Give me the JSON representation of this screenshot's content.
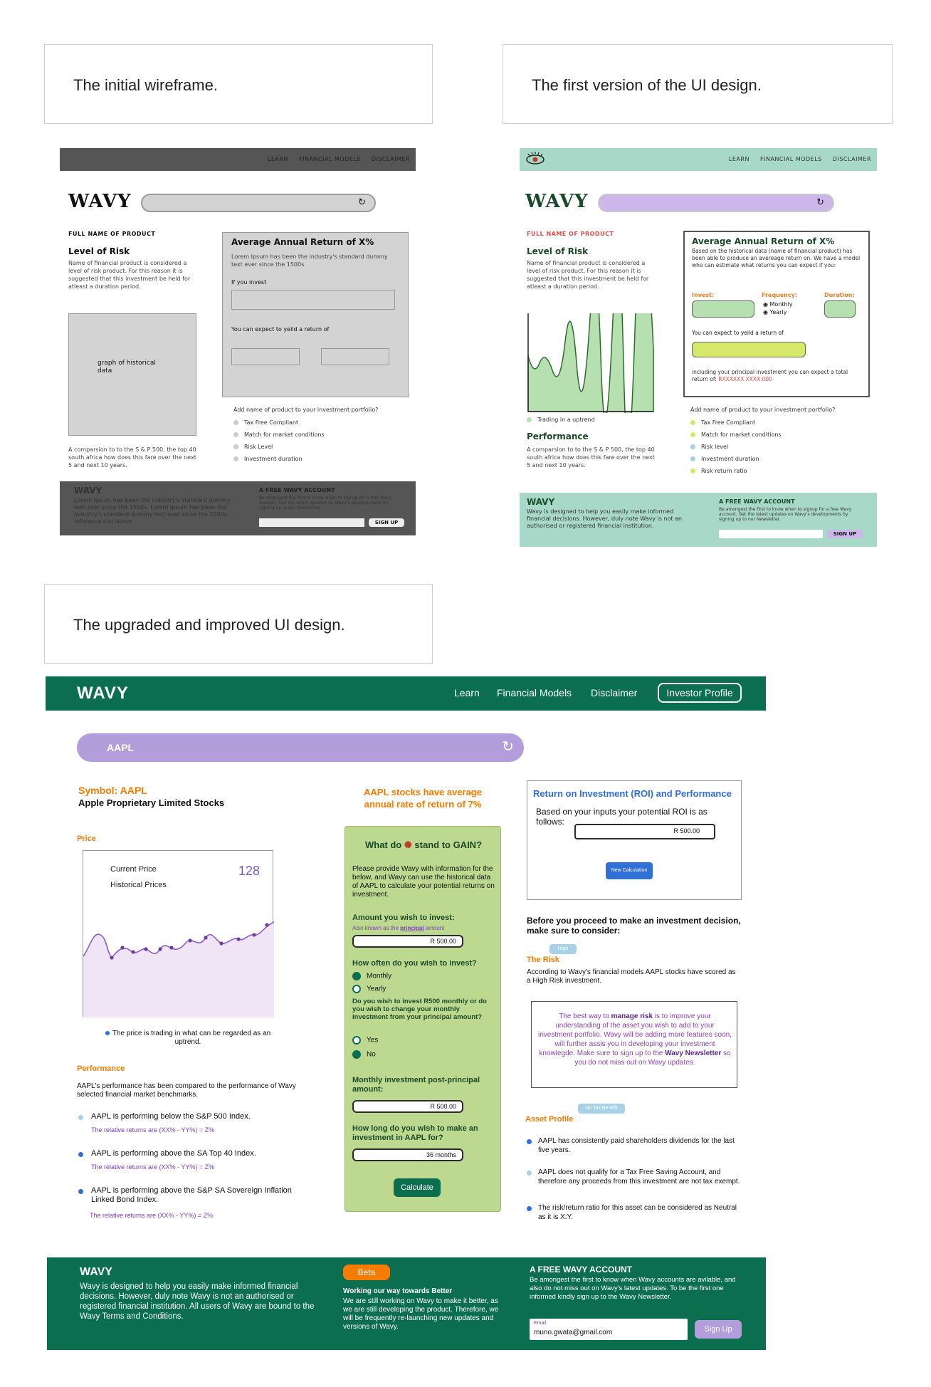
{
  "captions": {
    "wireframe": "The initial wireframe.",
    "first": "The first version of the UI design.",
    "upgraded": "The upgraded and improved UI design."
  },
  "colors": {
    "wireframe_dark": "#555555",
    "mint": "#a8d8c8",
    "lavender": "#cdb6ea",
    "brand_green": "#0b6e4f",
    "purple": "#b39ddb",
    "orange": "#f57c00",
    "calc_green": "#bcd98f"
  },
  "wireframe": {
    "nav": [
      "LEARN",
      "FINANCIAL MODELS",
      "DISCLAIMER"
    ],
    "logo": "WAVY",
    "search_icon": "refresh-icon",
    "product_name": "FULL NAME OF PRODUCT",
    "risk_title": "Level of Risk",
    "risk_text": "Name of financial product is considered a level of risk product. For this reason it is suggested that this investment be held for atleast a duration period.",
    "graph_label": "graph of historical data",
    "comparison": "A comparsion to to the S & P 500, the top 40 south africa how does this fare over the next 5 and next 10 years.",
    "return_title": "Average Annual Return of X%",
    "return_text": "Lorem Ipsum has been the industry's standard dummy text ever since the 1500s.",
    "if_invest": "If you invest",
    "expect": "You can expect to yeild a return of",
    "add_title": "Add name of product to your investment portfolio?",
    "add_items": [
      "Tax Free Compliant",
      "Match for market conditions",
      "Risk Level",
      "Investment duration"
    ],
    "footer_brand": "WAVY",
    "footer_text": "Lorem Ipsum has been the industry's standard dummy text ever since the 1500s. Lorem Ipsum has been the industry's standard dummy text ever since the 1500s. reference disclaimer",
    "footer_account_title": "A FREE WAVY ACCOUNT",
    "footer_account_text": "Be amongest the first to know when to signup for a free Wavy account. Get the latest updates on Wavy's developments by signing up to our Newsletter.",
    "signup": "SIGN UP"
  },
  "first": {
    "nav": [
      "LEARN",
      "FINANCIAL MODELS",
      "DISCLAIMER"
    ],
    "logo": "WAVY",
    "product_name": "FULL NAME OF PRODUCT",
    "risk_title": "Level of Risk",
    "risk_text": "Name of financial product is considered a level of risk product. For this reason it is suggested that this investment be held for atleast a duration period.",
    "trend_label": "Trading in a uptrend",
    "performance_title": "Performance",
    "comparison": "A comparsion to to the S & P 500, the top 40 south africa how does this fare over the next 5 and next 10 years.",
    "return_title": "Average Annual Return of X%",
    "return_text": "Based on the historical data (name of financial product) has been able to produce an avereage return on. We have a model who can estimate what returns you can expect if you:",
    "invest_label": "Invest:",
    "frequency_label": "Frequency:",
    "duration_label": "Duration:",
    "freq_options": [
      "Monthly",
      "Yearly"
    ],
    "expect": "You can expect to yeild a return of",
    "total_text": "including your principal investment you can expect a total return of:",
    "total_value": "RXXXXXX XXXX.000",
    "add_title": "Add name of product to your investment portfolio?",
    "add_items": [
      "Tax Free Compliant",
      "Match for market conditions",
      "Risk level",
      "Investment duration",
      "Risk return ratio"
    ],
    "footer_brand": "WAVY",
    "footer_text": "Wavy is designed to help you easily make informed financial decisions. However, duly note Wavy is not an authorised or registered financial institution.",
    "footer_account_title": "A FREE WAVY ACCOUNT",
    "footer_account_text": "Be amongest the first to know when to signup for a free Wavy account. Get the latest updates on Wavy's developments by signing up to our Newsletter.",
    "signup": "SIGN UP"
  },
  "upgraded": {
    "logo": "WAVY",
    "nav": [
      "Learn",
      "Financial Models",
      "Disclaimer"
    ],
    "profile_button": "Investor Profile",
    "search_value": "AAPL",
    "symbol": "Symbol: AAPL",
    "company": "Apple Proprietary Limited Stocks",
    "price_label": "Price",
    "current_price_label": "Current Price",
    "historical_label": "Historical Prices",
    "current_price": "128",
    "trend_note": "The price is trading in what can be regarded as an uptrend.",
    "performance_label": "Performance",
    "performance_text": "AAPL's performance has been compared to the performance of Wavy selected financial market benchmarks.",
    "benchmarks": [
      {
        "text": "AAPL is performing below the S&P 500 Index.",
        "sub": "The relative returns are (XX% - YY%) = Z%"
      },
      {
        "text": "AAPL is performing above the SA Top 40 Index.",
        "sub": "The relative returns are (XX% - YY%) = Z%"
      },
      {
        "text": "AAPL is performing above the S&P SA Sovereign Inflation Linked Bond Index.",
        "sub": "The relative returns are (XX% - YY%) = Z%"
      }
    ],
    "headline": "AAPL stocks have average annual rate of return of 7%",
    "calc": {
      "title_pre": "What do",
      "title_post": "stand to GAIN?",
      "intro": "Please provide Wavy with information for the below, and Wavy can use the historical data of AAPL to calculate your potential returns on investment.",
      "amount_label": "Amount you wish to invest:",
      "amount_hint_pre": "Also known as the",
      "amount_hint_link": "principal",
      "amount_hint_post": "amount",
      "amount_value": "R 500.00",
      "often_label": "How often do you wish to invest?",
      "often_options": [
        "Monthly",
        "Yearly"
      ],
      "change_label": "Do you wish to invest R500 monthly or do you wish to change your monthly investment from your principal amount?",
      "change_options": [
        "Yes",
        "No"
      ],
      "monthly_label": "Monthly investment post-principal amount:",
      "monthly_value": "R 500.00",
      "duration_label": "How long do you wish to make an investment in AAPL for?",
      "duration_value": "36 months",
      "calculate": "Calculate"
    },
    "roi": {
      "title": "Return on Investment (ROI) and Performance",
      "text": "Based on your inputs your potential ROI is as follows:",
      "value": "R 500.00",
      "button": "New Calculation"
    },
    "consider": "Before you proceed to make an investment decision, make sure to consider:",
    "risk_badge": "High",
    "risk_label": "The Risk",
    "risk_text": "According to Wavy's financial models AAPL stocks have scored as a High Risk investment.",
    "tip_pre": "The best way to",
    "tip_bold": "manage risk",
    "tip_mid": "is to improve your understanding of the asset you wish to add to your investment portfolio. Wavy will be adding more features soon, will further assis you in developing your investment knowlegde. Make sure to sign up to the",
    "tip_bold2": "Wavy Newsletter",
    "tip_post": "so you do not miss out on Wavy updates.",
    "tax_badge": "No Tax Benefit",
    "asset_label": "Asset Profile",
    "asset_items": [
      "AAPL has consistently paid shareholders dividends for the last five years.",
      "AAPL does not qualify for a Tax Free Saving Account, and therefore any proceeds from this investment are not tax exempt.",
      "The risk/return ratio for this asset can be considered as Neutral as it is X:Y."
    ],
    "footer": {
      "brand": "WAVY",
      "text": "Wavy is designed to help you easily make informed financial decisions. However, duly note Wavy is not an authorised or registered financial institution. All users of Wavy are bound to the Wavy Terms and Conditions.",
      "beta": "Beta",
      "beta_title": "Working our way towards Better",
      "beta_text": "We are still working on Wavy to make it better, as we are still developing the product. Therefore, we will be frequently re-launching new updates and versions of Wavy.",
      "account_title": "A FREE WAVY ACCOUNT",
      "account_text": "Be amongest the first to know when Wavy accounts are avilable, and also do not miss out on Wavy's latest updates. To be the first one informed kindly sign up to the Wavy Newsletter.",
      "email_label": "Email",
      "email_value": "muno.gwata@gmail.com",
      "signup": "Sign Up"
    }
  }
}
